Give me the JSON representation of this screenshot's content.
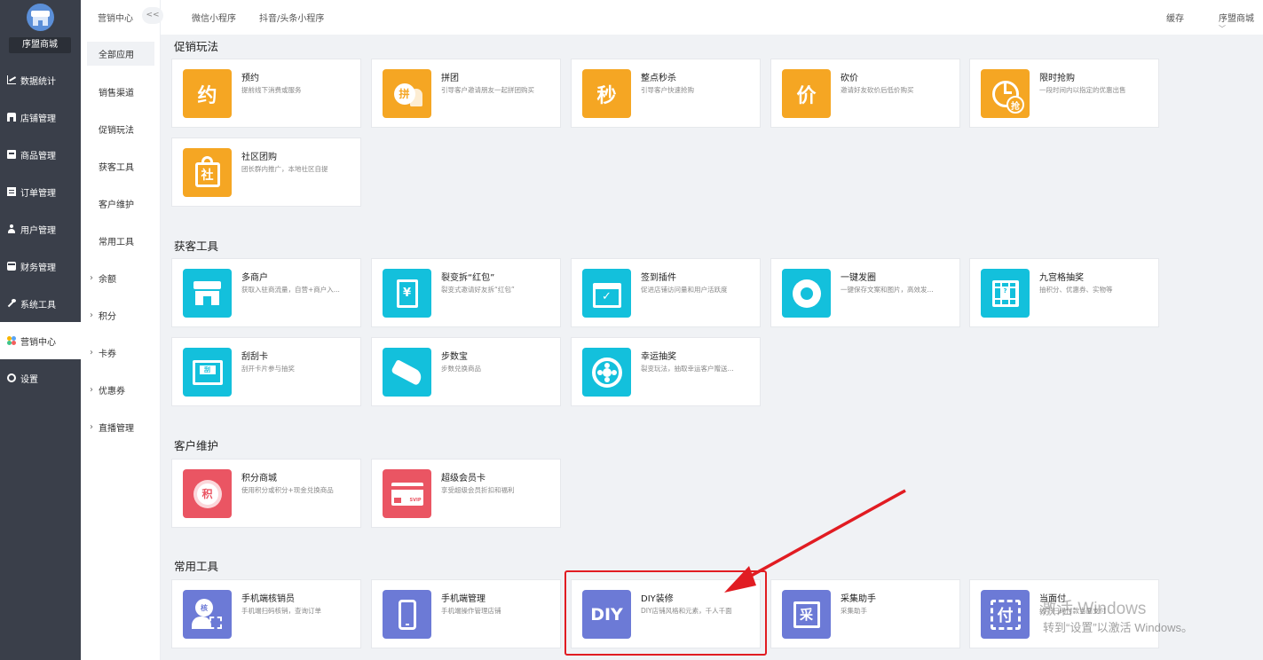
{
  "app": {
    "shop_name": "序盟商城"
  },
  "sidebar": {
    "items": [
      {
        "label": "数据统计",
        "icon": "chart-icon"
      },
      {
        "label": "店铺管理",
        "icon": "shop-icon"
      },
      {
        "label": "商品管理",
        "icon": "goods-icon"
      },
      {
        "label": "订单管理",
        "icon": "order-icon"
      },
      {
        "label": "用户管理",
        "icon": "user-icon"
      },
      {
        "label": "财务管理",
        "icon": "finance-icon"
      },
      {
        "label": "系统工具",
        "icon": "wrench-icon"
      },
      {
        "label": "营销中心",
        "icon": "marketing-icon"
      },
      {
        "label": "设置",
        "icon": "settings-icon"
      }
    ]
  },
  "subnav": {
    "title": "营销中心",
    "collapse": "<<",
    "items": [
      {
        "label": "全部应用"
      },
      {
        "label": "销售渠道"
      },
      {
        "label": "促销玩法"
      },
      {
        "label": "获客工具"
      },
      {
        "label": "客户维护"
      },
      {
        "label": "常用工具"
      },
      {
        "label": "余额"
      },
      {
        "label": "积分"
      },
      {
        "label": "卡券"
      },
      {
        "label": "优惠券"
      },
      {
        "label": "直播管理"
      }
    ]
  },
  "topbar": {
    "tabs": [
      "微信小程序",
      "抖音/头条小程序"
    ],
    "cache": "缓存",
    "user": "序盟商城"
  },
  "sections": {
    "promo": {
      "title": "促销玩法",
      "cards": [
        {
          "title": "预约",
          "desc": "提前线下消费或服务",
          "glyph": "约"
        },
        {
          "title": "拼团",
          "desc": "引导客户邀请朋友一起拼团购买",
          "glyph": "拼"
        },
        {
          "title": "整点秒杀",
          "desc": "引导客户快速抢购",
          "glyph": "秒"
        },
        {
          "title": "砍价",
          "desc": "邀请好友砍价后低价购买",
          "glyph": "价"
        },
        {
          "title": "限时抢购",
          "desc": "一段时间内以指定的优惠出售",
          "glyph": "抢"
        },
        {
          "title": "社区团购",
          "desc": "团长群内推广，本地社区自提",
          "glyph": "社"
        }
      ]
    },
    "acquire": {
      "title": "获客工具",
      "cards": [
        {
          "title": "多商户",
          "desc": "获取入驻商流量，自营+商户入..."
        },
        {
          "title": "裂变拆“红包”",
          "desc": "裂变式邀请好友拆“红包”",
          "glyph": "¥"
        },
        {
          "title": "签到插件",
          "desc": "促进店铺访问量和用户活跃度"
        },
        {
          "title": "一键发圈",
          "desc": "一键保存文案和图片，高效发..."
        },
        {
          "title": "九宫格抽奖",
          "desc": "抽积分、优惠券、实物等",
          "glyph": "?"
        },
        {
          "title": "刮刮卡",
          "desc": "刮开卡片参与抽奖",
          "glyph": "刮"
        },
        {
          "title": "步数宝",
          "desc": "步数兑换商品"
        },
        {
          "title": "幸运抽奖",
          "desc": "裂变玩法，抽取幸运客户赠送..."
        }
      ]
    },
    "retain": {
      "title": "客户维护",
      "cards": [
        {
          "title": "积分商城",
          "desc": "使用积分或积分+现金兑换商品",
          "glyph": "积"
        },
        {
          "title": "超级会员卡",
          "desc": "享受超级会员折扣和福利",
          "glyph": "SVIP"
        }
      ]
    },
    "tools": {
      "title": "常用工具",
      "cards": [
        {
          "title": "手机端核销员",
          "desc": "手机端扫码核销，查询订单",
          "glyph": "核"
        },
        {
          "title": "手机端管理",
          "desc": "手机端操作管理店铺"
        },
        {
          "title": "DIY装修",
          "desc": "DIY店铺风格和元素，千人千面",
          "glyph": "DIY"
        },
        {
          "title": "采集助手",
          "desc": "采集助手",
          "glyph": "采"
        },
        {
          "title": "当面付",
          "desc": "线下扫码付款当面支付",
          "glyph": "付"
        }
      ]
    }
  },
  "watermark": {
    "line1": "激活 Windows",
    "line2": "转到“设置”以激活 Windows。"
  },
  "colors": {
    "sidebar": "#3a3f4a",
    "orange": "#f5a623",
    "cyan": "#13c0dc",
    "red": "#ea5563",
    "purple": "#6c7ad6",
    "annotation": "#e11c22"
  }
}
